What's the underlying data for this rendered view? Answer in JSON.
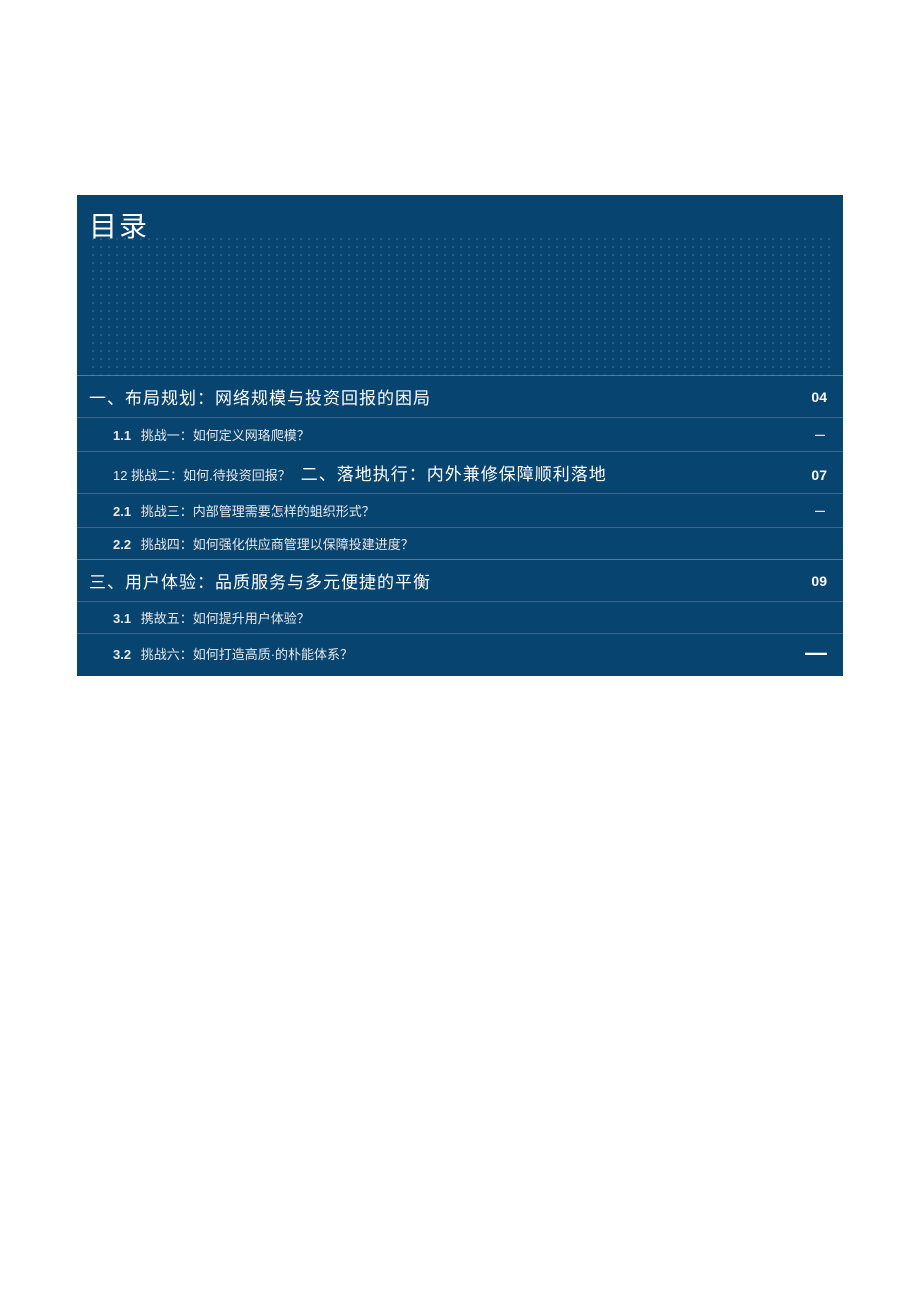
{
  "title": "目录",
  "sections": [
    {
      "heading": "一、布局规划：网络规模与投资回报的困局",
      "page": "04",
      "subs": [
        {
          "num": "1.1",
          "text": "挑战一：如何定义网珞爬模？",
          "marker": "–"
        }
      ],
      "combo": {
        "sub_num": "12",
        "sub_text": "挑战二：如何.待投资回报？",
        "main": "二、落地执行：内外兼修保障顺利落地",
        "page": "07"
      },
      "after_combo_subs": [
        {
          "num": "2.1",
          "text": "挑战三：内部管理需要怎样的蛆织形式？",
          "marker": "–"
        },
        {
          "num": "2.2",
          "text": "挑战四：如何强化供应商管理以保障投建进度？",
          "marker": ""
        }
      ]
    },
    {
      "heading": "三、用户体验：品质服务与多元便捷的平衡",
      "page": "09",
      "subs": [
        {
          "num": "3.1",
          "text": "携故五：如何提升用户体验？",
          "marker": ""
        },
        {
          "num": "3.2",
          "text": "挑战六：如何打造高质·的朴能体系？",
          "marker": "—"
        }
      ]
    }
  ]
}
